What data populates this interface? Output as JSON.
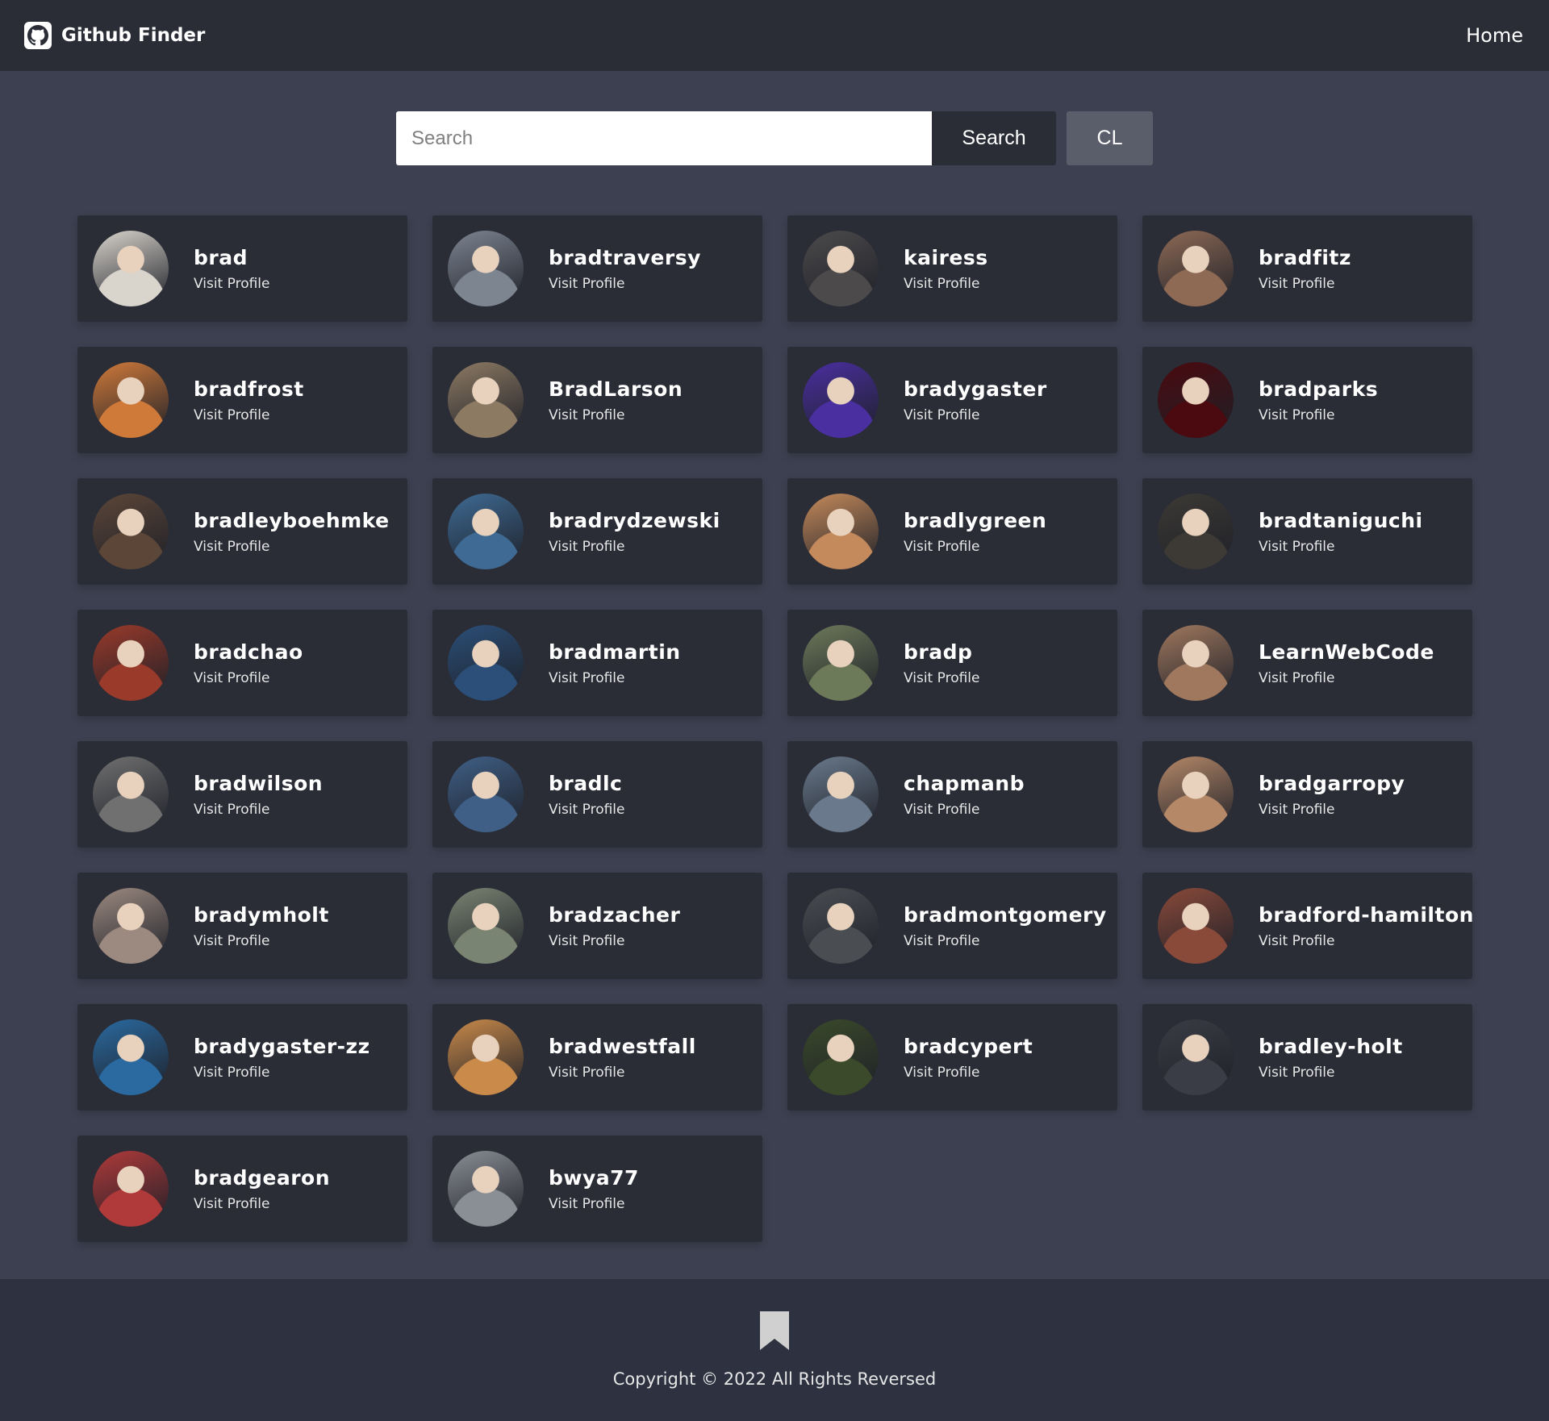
{
  "navbar": {
    "brand_title": "Github Finder",
    "brand_icon": "github-icon",
    "home_link": "Home"
  },
  "search": {
    "placeholder": "Search",
    "search_button": "Search",
    "clear_button": "CL"
  },
  "users": [
    {
      "login": "brad",
      "link": "Visit Profile",
      "avatar_color": "#d9d4cc"
    },
    {
      "login": "bradtraversy",
      "link": "Visit Profile",
      "avatar_color": "#7d8591"
    },
    {
      "login": "kairess",
      "link": "Visit Profile",
      "avatar_color": "#4c4a4b"
    },
    {
      "login": "bradfitz",
      "link": "Visit Profile",
      "avatar_color": "#8e6a55"
    },
    {
      "login": "bradfrost",
      "link": "Visit Profile",
      "avatar_color": "#d07a3a"
    },
    {
      "login": "BradLarson",
      "link": "Visit Profile",
      "avatar_color": "#8d7a63"
    },
    {
      "login": "bradygaster",
      "link": "Visit Profile",
      "avatar_color": "#4a2fa0"
    },
    {
      "login": "bradparks",
      "link": "Visit Profile",
      "avatar_color": "#4a0a0f"
    },
    {
      "login": "bradleyboehmke",
      "link": "Visit Profile",
      "avatar_color": "#5c4638"
    },
    {
      "login": "bradrydzewski",
      "link": "Visit Profile",
      "avatar_color": "#3e6a93"
    },
    {
      "login": "bradlygreen",
      "link": "Visit Profile",
      "avatar_color": "#c58a5b"
    },
    {
      "login": "bradtaniguchi",
      "link": "Visit Profile",
      "avatar_color": "#3d3a35"
    },
    {
      "login": "bradchao",
      "link": "Visit Profile",
      "avatar_color": "#9a3a2a"
    },
    {
      "login": "bradmartin",
      "link": "Visit Profile",
      "avatar_color": "#2b4f78"
    },
    {
      "login": "bradp",
      "link": "Visit Profile",
      "avatar_color": "#6d7a5a"
    },
    {
      "login": "LearnWebCode",
      "link": "Visit Profile",
      "avatar_color": "#a0785e"
    },
    {
      "login": "bradwilson",
      "link": "Visit Profile",
      "avatar_color": "#707070"
    },
    {
      "login": "bradlc",
      "link": "Visit Profile",
      "avatar_color": "#3f5f86"
    },
    {
      "login": "chapmanb",
      "link": "Visit Profile",
      "avatar_color": "#6a7a8c"
    },
    {
      "login": "bradgarropy",
      "link": "Visit Profile",
      "avatar_color": "#b58868"
    },
    {
      "login": "bradymholt",
      "link": "Visit Profile",
      "avatar_color": "#9c8a80"
    },
    {
      "login": "bradzacher",
      "link": "Visit Profile",
      "avatar_color": "#7a8472"
    },
    {
      "login": "bradmontgomery",
      "link": "Visit Profile",
      "avatar_color": "#4a4e52"
    },
    {
      "login": "bradford-hamilton",
      "link": "Visit Profile",
      "avatar_color": "#8a4a3a"
    },
    {
      "login": "bradygaster-zz",
      "link": "Visit Profile",
      "avatar_color": "#2a6aa0"
    },
    {
      "login": "bradwestfall",
      "link": "Visit Profile",
      "avatar_color": "#c98a4a"
    },
    {
      "login": "bradcypert",
      "link": "Visit Profile",
      "avatar_color": "#3a4a2a"
    },
    {
      "login": "bradley-holt",
      "link": "Visit Profile",
      "avatar_color": "#3a3d45"
    },
    {
      "login": "bradgearon",
      "link": "Visit Profile",
      "avatar_color": "#b03a3a"
    },
    {
      "login": "bwya77",
      "link": "Visit Profile",
      "avatar_color": "#8a8e95"
    }
  ],
  "footer": {
    "icon": "bookmark-icon",
    "copyright": "Copyright © 2022 All Rights Reversed"
  },
  "colors": {
    "background": "#3d4050",
    "navbar": "#2a2c36",
    "card": "#2a2c36",
    "footer": "#2d3140",
    "clear_button": "#5a5e6b"
  }
}
